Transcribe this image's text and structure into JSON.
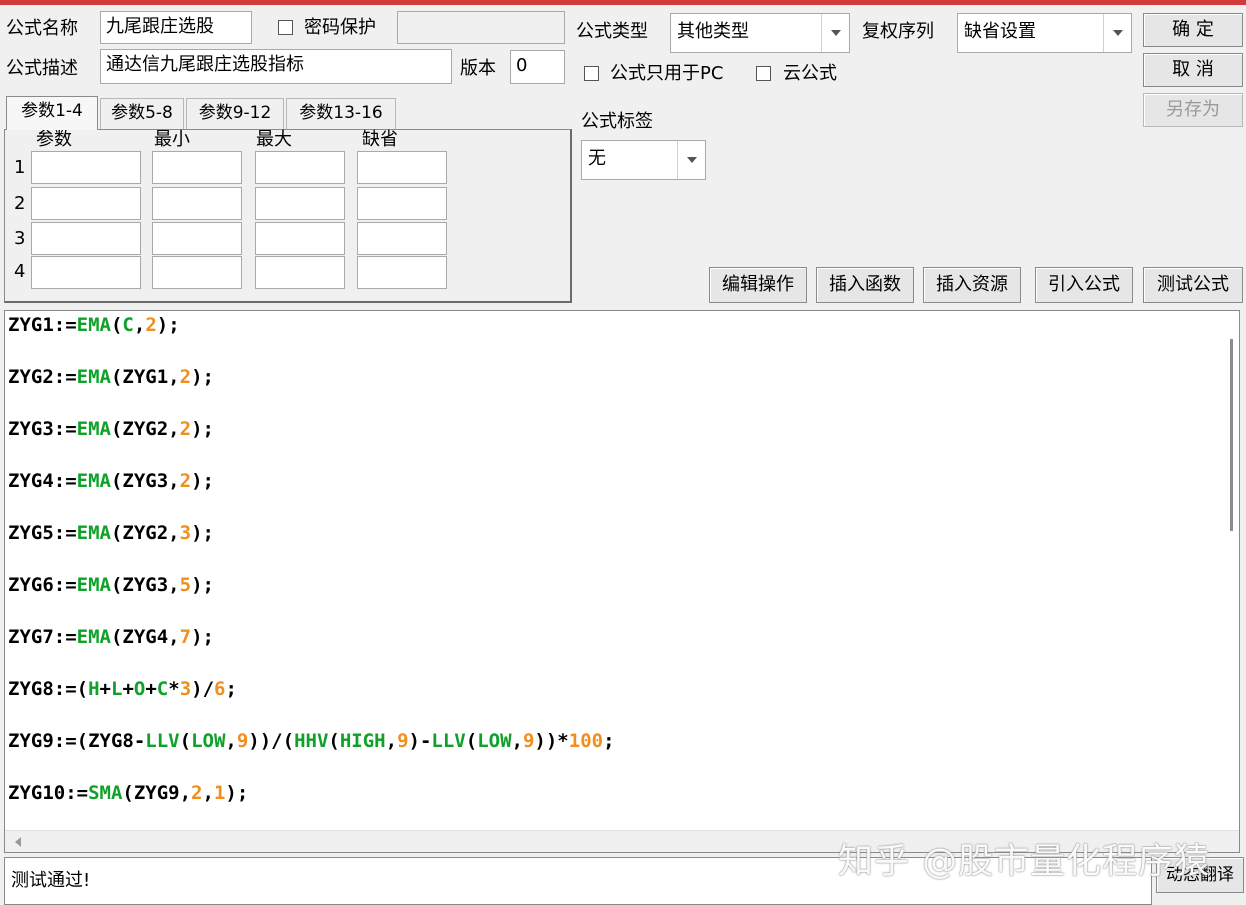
{
  "form": {
    "name_label": "公式名称",
    "name_value": "九尾跟庄选股",
    "password_label": "密码保护",
    "password_value": "",
    "desc_label": "公式描述",
    "desc_value": "通达信九尾跟庄选股指标",
    "version_label": "版本",
    "version_value": "0",
    "type_label": "公式类型",
    "type_value": "其他类型",
    "adjust_label": "复权序列",
    "adjust_value": "缺省设置",
    "pc_only_label": "公式只用于PC",
    "cloud_label": "云公式",
    "tag_label": "公式标签",
    "tag_value": "无"
  },
  "buttons": {
    "ok": "确  定",
    "cancel": "取  消",
    "save_as": "另存为",
    "edit_ops": "编辑操作",
    "insert_func": "插入函数",
    "insert_res": "插入资源",
    "import_formula": "引入公式",
    "test_formula": "测试公式",
    "dynamic_translate": "动态翻译"
  },
  "tabs": [
    "参数1-4",
    "参数5-8",
    "参数9-12",
    "参数13-16"
  ],
  "param_headers": [
    "参数",
    "最小",
    "最大",
    "缺省"
  ],
  "param_rows": [
    "1",
    "2",
    "3",
    "4"
  ],
  "code_lines": [
    [
      [
        "k",
        "ZYG1:="
      ],
      [
        "f",
        "EMA"
      ],
      [
        "k",
        "("
      ],
      [
        "f",
        "C"
      ],
      [
        "k",
        ","
      ],
      [
        "n",
        "2"
      ],
      [
        "k",
        ");"
      ]
    ],
    [
      [
        "k",
        "ZYG2:="
      ],
      [
        "f",
        "EMA"
      ],
      [
        "k",
        "(ZYG1,"
      ],
      [
        "n",
        "2"
      ],
      [
        "k",
        ");"
      ]
    ],
    [
      [
        "k",
        "ZYG3:="
      ],
      [
        "f",
        "EMA"
      ],
      [
        "k",
        "(ZYG2,"
      ],
      [
        "n",
        "2"
      ],
      [
        "k",
        ");"
      ]
    ],
    [
      [
        "k",
        "ZYG4:="
      ],
      [
        "f",
        "EMA"
      ],
      [
        "k",
        "(ZYG3,"
      ],
      [
        "n",
        "2"
      ],
      [
        "k",
        ");"
      ]
    ],
    [
      [
        "k",
        "ZYG5:="
      ],
      [
        "f",
        "EMA"
      ],
      [
        "k",
        "(ZYG2,"
      ],
      [
        "n",
        "3"
      ],
      [
        "k",
        ");"
      ]
    ],
    [
      [
        "k",
        "ZYG6:="
      ],
      [
        "f",
        "EMA"
      ],
      [
        "k",
        "(ZYG3,"
      ],
      [
        "n",
        "5"
      ],
      [
        "k",
        ");"
      ]
    ],
    [
      [
        "k",
        "ZYG7:="
      ],
      [
        "f",
        "EMA"
      ],
      [
        "k",
        "(ZYG4,"
      ],
      [
        "n",
        "7"
      ],
      [
        "k",
        ");"
      ]
    ],
    [
      [
        "k",
        "ZYG8:=("
      ],
      [
        "f",
        "H"
      ],
      [
        "k",
        "+"
      ],
      [
        "f",
        "L"
      ],
      [
        "k",
        "+"
      ],
      [
        "f",
        "O"
      ],
      [
        "k",
        "+"
      ],
      [
        "f",
        "C"
      ],
      [
        "k",
        "*"
      ],
      [
        "n",
        "3"
      ],
      [
        "k",
        ")/"
      ],
      [
        "n",
        "6"
      ],
      [
        "k",
        ";"
      ]
    ],
    [
      [
        "k",
        "ZYG9:=(ZYG8-"
      ],
      [
        "f",
        "LLV"
      ],
      [
        "k",
        "("
      ],
      [
        "f",
        "LOW"
      ],
      [
        "k",
        ","
      ],
      [
        "n",
        "9"
      ],
      [
        "k",
        "))/("
      ],
      [
        "f",
        "HHV"
      ],
      [
        "k",
        "("
      ],
      [
        "f",
        "HIGH"
      ],
      [
        "k",
        ","
      ],
      [
        "n",
        "9"
      ],
      [
        "k",
        ")-"
      ],
      [
        "f",
        "LLV"
      ],
      [
        "k",
        "("
      ],
      [
        "f",
        "LOW"
      ],
      [
        "k",
        ","
      ],
      [
        "n",
        "9"
      ],
      [
        "k",
        "))*"
      ],
      [
        "n",
        "100"
      ],
      [
        "k",
        ";"
      ]
    ],
    [
      [
        "k",
        "ZYG10:="
      ],
      [
        "f",
        "SMA"
      ],
      [
        "k",
        "(ZYG9,"
      ],
      [
        "n",
        "2"
      ],
      [
        "k",
        ","
      ],
      [
        "n",
        "1"
      ],
      [
        "k",
        ");"
      ]
    ]
  ],
  "status": "测试通过!",
  "watermark": "知乎 @股市量化程序猿"
}
